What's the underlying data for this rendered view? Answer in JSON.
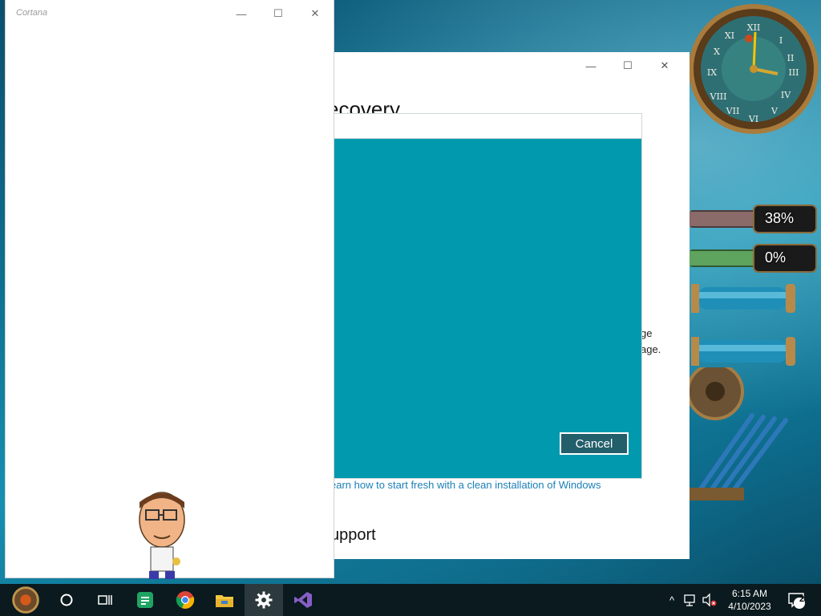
{
  "cortana_window": {
    "title": "Cortana",
    "controls": {
      "minimize": "—",
      "maximize": "☐",
      "close": "✕"
    }
  },
  "settings_window": {
    "controls": {
      "minimize": "—",
      "maximize": "☐",
      "close": "✕"
    },
    "heading_fragment": "ecovery",
    "text_fragment_1": "ge",
    "text_fragment_2": "age.",
    "link_fragment": "earn how to start fresh with a clean installation of Windows",
    "support_fragment": "upport"
  },
  "dialog": {
    "cancel_label": "Cancel",
    "background_color": "#0099ad"
  },
  "gadgets": {
    "meter1_label": "38%",
    "meter1_value": 0.38,
    "meter2_label": "0%",
    "meter2_value": 0.0
  },
  "taskbar": {
    "items": [
      "start-button",
      "cortana-search",
      "task-view",
      "spreadsheet-app",
      "chrome",
      "file-explorer",
      "settings",
      "visual-studio"
    ],
    "active_item": "settings",
    "time": "6:15 AM",
    "date": "4/10/2023",
    "notification_count": "2",
    "tray_chevron": "^"
  }
}
